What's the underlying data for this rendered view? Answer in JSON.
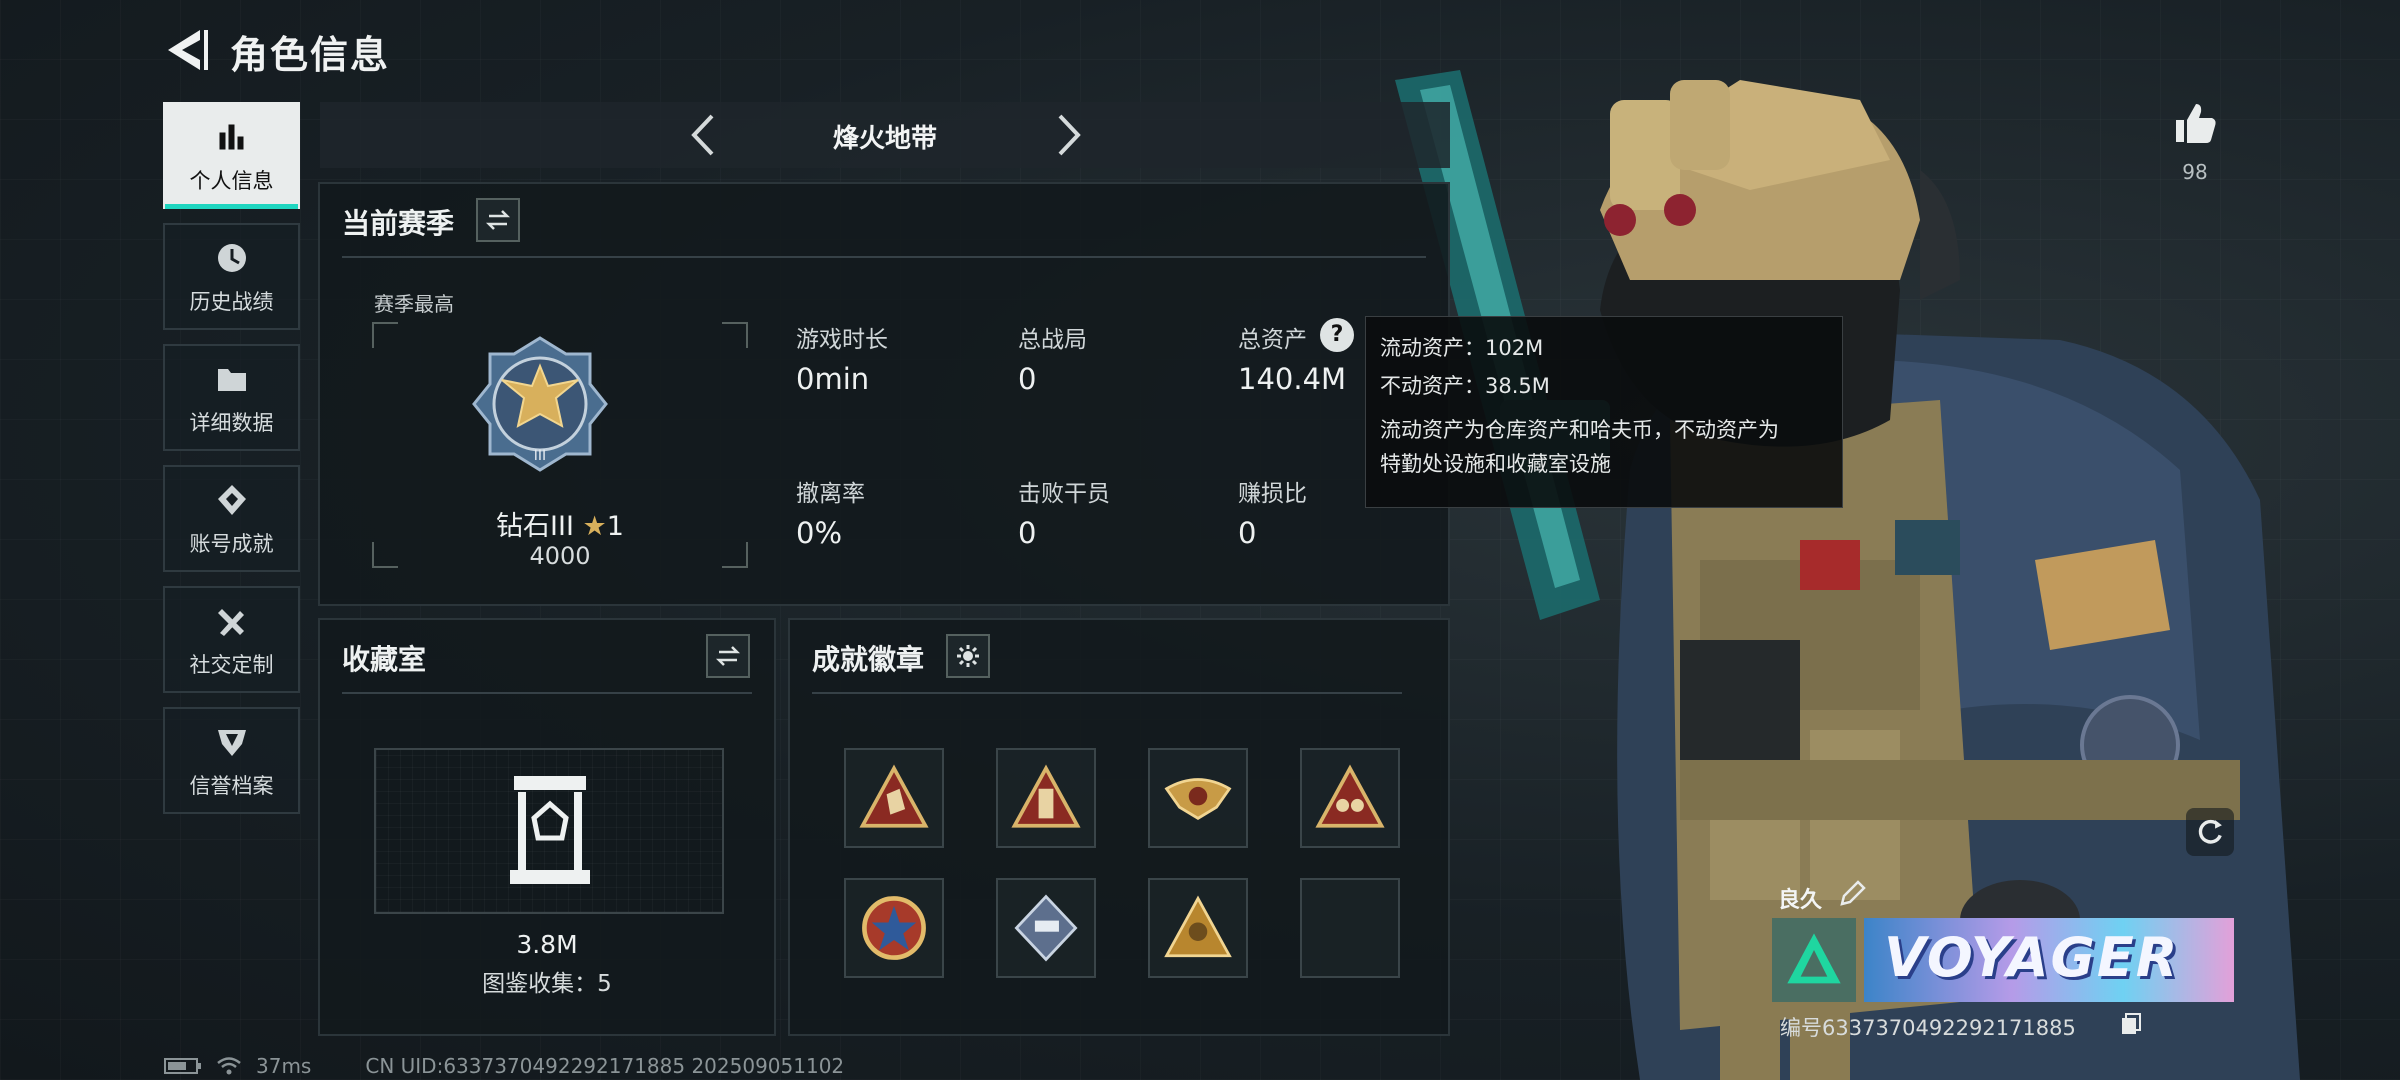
{
  "header": {
    "title": "角色信息"
  },
  "nav": {
    "items": [
      {
        "label": "个人信息",
        "icon": "bar-chart-icon",
        "active": true
      },
      {
        "label": "历史战绩",
        "icon": "clock-icon"
      },
      {
        "label": "详细数据",
        "icon": "folder-icon"
      },
      {
        "label": "账号成就",
        "icon": "medal-icon"
      },
      {
        "label": "社交定制",
        "icon": "tools-icon"
      },
      {
        "label": "信誉档案",
        "icon": "shield-icon"
      }
    ]
  },
  "mode": {
    "title": "烽火地带"
  },
  "season": {
    "title": "当前赛季",
    "best_label": "赛季最高",
    "rank_name": "钻石III",
    "rank_stars": "1",
    "rank_points": "4000",
    "stats": [
      {
        "label": "游戏时长",
        "value": "0min"
      },
      {
        "label": "总战局",
        "value": "0"
      },
      {
        "label": "总资产",
        "value": "140.4M"
      },
      {
        "label": "撤离率",
        "value": "0%"
      },
      {
        "label": "击败干员",
        "value": "0"
      },
      {
        "label": "赚损比",
        "value": "0"
      }
    ]
  },
  "tooltip": {
    "line1": "流动资产：102M",
    "line2": "不动资产：38.5M",
    "line3": "流动资产为仓库资产和哈夫币，不动资产为",
    "line4": "特勤处设施和收藏室设施"
  },
  "collection": {
    "title": "收藏室",
    "value": "3.8M",
    "count_text": "图鉴收集：5"
  },
  "achievements": {
    "title": "成就徽章",
    "badges": [
      "badge-hand",
      "badge-tower",
      "badge-eagle",
      "badge-team",
      "badge-star-roundel",
      "badge-diamond-gun",
      "badge-triangle-soldier",
      "badge-empty"
    ]
  },
  "likes": {
    "count": "98"
  },
  "card": {
    "name": "良久",
    "banner_text": "VOYAGER",
    "id_text": "编号6337370492292171885"
  },
  "status": {
    "ping": "37ms",
    "uid": "CN UID:6337370492292171885 20250905110​2"
  },
  "colors": {
    "accent": "#1fd6c0",
    "gold": "#d8b05c",
    "panel_bg": "#12191d"
  }
}
